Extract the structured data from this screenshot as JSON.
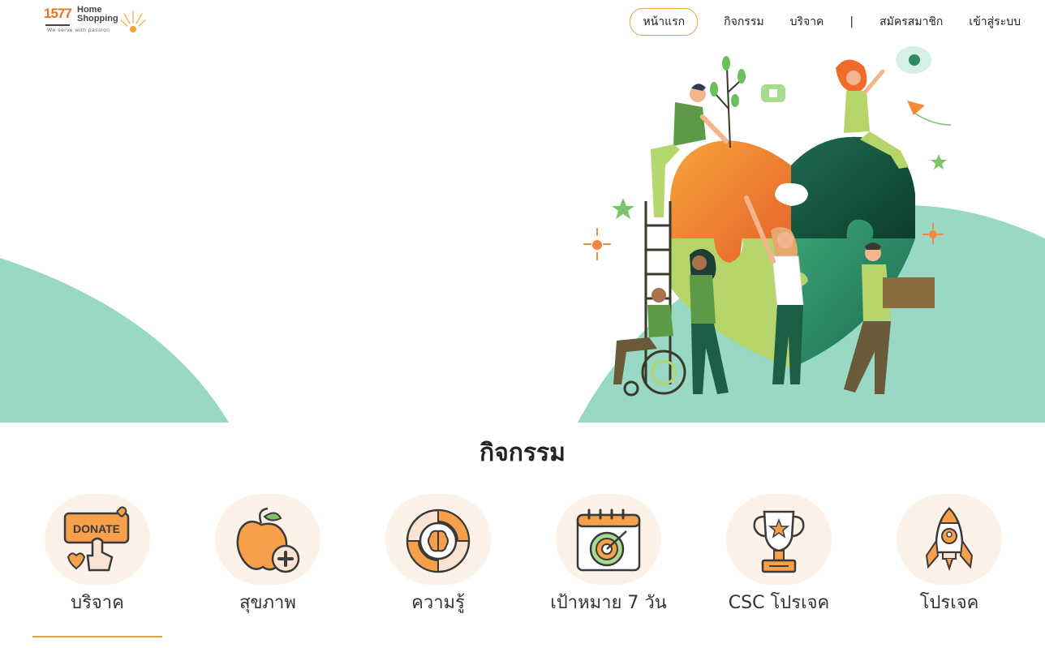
{
  "brand": {
    "number": "1577",
    "name_line1": "Home",
    "name_line2": "Shopping",
    "tagline": "We serve with passion"
  },
  "nav": {
    "items": [
      {
        "label": "หน้าแรก",
        "active": true
      },
      {
        "label": "กิจกรรม"
      },
      {
        "label": "บริจาค"
      }
    ],
    "separator": "|",
    "register": "สมัครสมาชิก",
    "login": "เข้าสู่ระบบ"
  },
  "hero": {
    "donation_label": "DONATE"
  },
  "section": {
    "title": "กิจกรรม"
  },
  "categories": [
    {
      "label": "บริจาค",
      "icon": "donate-sign-icon"
    },
    {
      "label": "สุขภาพ",
      "icon": "apple-health-icon"
    },
    {
      "label": "ความรู้",
      "icon": "brain-knowledge-icon"
    },
    {
      "label": "เป้าหมาย 7 วัน",
      "icon": "calendar-target-icon"
    },
    {
      "label": "CSC โปรเจค",
      "icon": "trophy-icon"
    },
    {
      "label": "โปรเจค",
      "icon": "rocket-icon"
    }
  ],
  "colors": {
    "accent": "#e8a04a",
    "mint": "#98d8c4",
    "circle_bg": "#fdf2e7",
    "orange": "#f08a3a",
    "dark_green": "#1d5e46"
  }
}
